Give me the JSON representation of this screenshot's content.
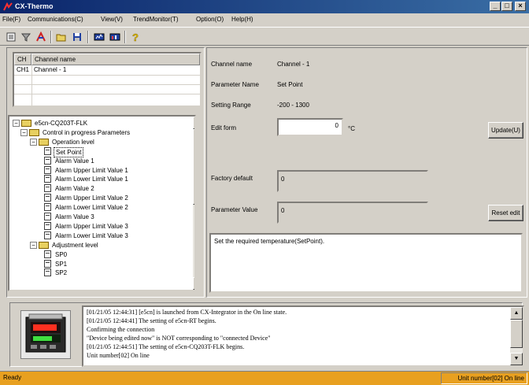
{
  "window": {
    "title": "CX-Thermo"
  },
  "menu": [
    "File(F)",
    "Communications(C)",
    "View(V)",
    "TrendMonitor(T)",
    "Option(O)",
    "Help(H)"
  ],
  "toolbar": {
    "icons": [
      "tree-toggle-icon",
      "filter-icon",
      "online-icon",
      "open-folder-icon",
      "save-icon",
      "monitor-icon",
      "trend-icon",
      "help-icon"
    ]
  },
  "channel_list": {
    "headers": [
      "CH",
      "Channel name"
    ],
    "rows": [
      [
        "CH1",
        "Channel - 1"
      ]
    ]
  },
  "tree": {
    "items": [
      {
        "label": "e5cn-CQ203T-FLK",
        "level": 0,
        "type": "folder",
        "expanded": true
      },
      {
        "label": "Control in progress Parameters",
        "level": 1,
        "type": "folder",
        "expanded": true
      },
      {
        "label": "Operation level",
        "level": 2,
        "type": "folder",
        "expanded": true
      },
      {
        "label": "Set Point",
        "level": 3,
        "type": "doc",
        "selected": true
      },
      {
        "label": "Alarm Value 1",
        "level": 3,
        "type": "doc"
      },
      {
        "label": "Alarm Upper Limit Value 1",
        "level": 3,
        "type": "doc"
      },
      {
        "label": "Alarm Lower Limit Value 1",
        "level": 3,
        "type": "doc"
      },
      {
        "label": "Alarm Value 2",
        "level": 3,
        "type": "doc"
      },
      {
        "label": "Alarm Upper Limit Value 2",
        "level": 3,
        "type": "doc"
      },
      {
        "label": "Alarm Lower Limit Value 2",
        "level": 3,
        "type": "doc"
      },
      {
        "label": "Alarm Value 3",
        "level": 3,
        "type": "doc"
      },
      {
        "label": "Alarm Upper Limit Value 3",
        "level": 3,
        "type": "doc"
      },
      {
        "label": "Alarm Lower Limit Value 3",
        "level": 3,
        "type": "doc"
      },
      {
        "label": "Adjustment level",
        "level": 2,
        "type": "folder",
        "expanded": true
      },
      {
        "label": "SP0",
        "level": 3,
        "type": "doc"
      },
      {
        "label": "SP1",
        "level": 3,
        "type": "doc"
      },
      {
        "label": "SP2",
        "level": 3,
        "type": "doc"
      }
    ]
  },
  "detail": {
    "channel_name_label": "Channel name",
    "channel_name_value": "Channel - 1",
    "parameter_name_label": "Parameter Name",
    "parameter_name_value": "Set Point",
    "setting_range_label": "Setting Range",
    "setting_range_value": "-200 - 1300",
    "edit_form_label": "Edit form",
    "edit_form_value": "0",
    "unit": "°C",
    "update_button": "Update(U)",
    "factory_default_label": "Factory default",
    "factory_default_value": "0",
    "parameter_value_label": "Parameter Value",
    "parameter_value_value": "0",
    "reset_button": "Reset edit",
    "description": "Set the required temperature(SetPoint)."
  },
  "log": {
    "lines": [
      "[01/21/05 12:44:31] [e5cn] is launched from CX-Integrator in the On line state.",
      "[01/21/05 12:44:41] The setting of e5cn-RT begins.",
      "Confirming the connection",
      "\"Device being edited now\" is NOT corresponding to \"connected Device\"",
      "[01/21/05 12:44:51] The setting of e5cn-CQ203T-FLK begins.",
      "Unit number[02]  On line"
    ]
  },
  "status": {
    "left": "Ready",
    "right": "Unit number[02]  On line"
  },
  "colors": {
    "title_bar": "#0a246a",
    "status_bar": "#e8a020",
    "face": "#d4d0c8"
  }
}
